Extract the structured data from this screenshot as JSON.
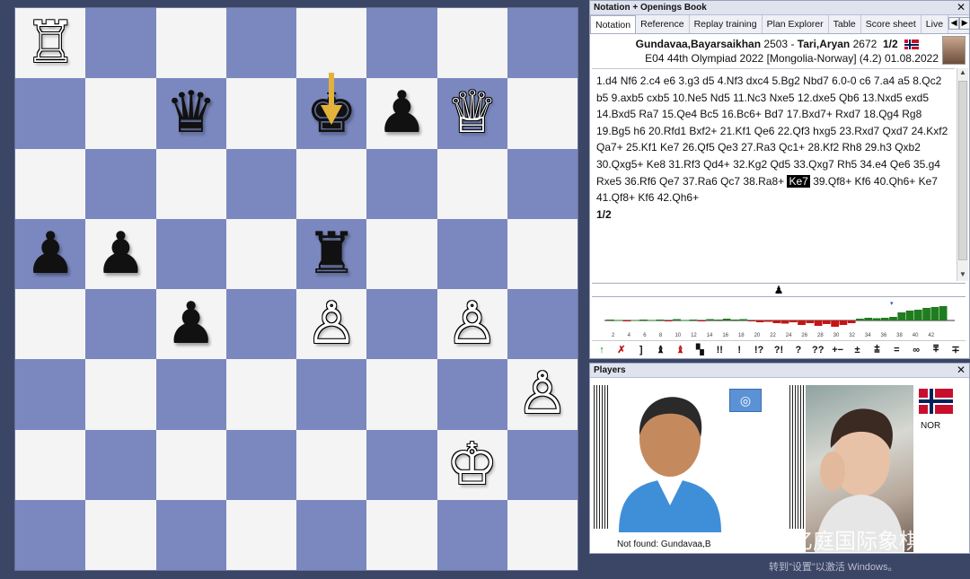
{
  "window": {
    "notation_title": "Notation + Openings Book",
    "players_title": "Players"
  },
  "tabs": [
    {
      "label": "Notation"
    },
    {
      "label": "Reference"
    },
    {
      "label": "Replay training"
    },
    {
      "label": "Plan Explorer"
    },
    {
      "label": "Table"
    },
    {
      "label": "Score sheet"
    },
    {
      "label": "Live"
    }
  ],
  "game": {
    "white": "Gundavaa,Bayarsaikhan",
    "white_elo": "2503",
    "separator": " - ",
    "black": "Tari,Aryan",
    "black_elo": "2672",
    "result": "1/2",
    "line2": "E04 44th Olympiad 2022 [Mongolia-Norway] (4.2) 01.08.2022"
  },
  "moves_before": "1.d4  Nf6  2.c4  e6  3.g3  d5  4.Nf3  dxc4  5.Bg2  Nbd7  6.0-0  c6  7.a4  a5  8.Qc2  b5  9.axb5  cxb5  10.Ne5  Nd5  11.Nc3  Nxe5  12.dxe5  Qb6  13.Nxd5  exd5  14.Bxd5  Ra7  15.Qe4  Bc5  16.Bc6+  Bd7  17.Bxd7+  Rxd7  18.Qg4  Rg8  19.Bg5  h6  20.Rfd1  Bxf2+  21.Kf1  Qe6  22.Qf3  hxg5  23.Rxd7  Qxd7  24.Kxf2  Qa7+  25.Kf1  Ke7  26.Qf5  Qe3  27.Ra3  Qc1+  28.Kf2  Rh8  29.h3  Qxb2  30.Qxg5+  Ke8  31.Rf3  Qd4+  32.Kg2  Qd5  33.Qxg7  Rh5  34.e4  Qe6  35.g4  Rxe5  36.Rf6  Qe7  37.Ra6  Qc7  38.Ra8+",
  "current_move": "Ke7",
  "moves_after": "39.Qf8+  Kf6  40.Qh6+  Ke7  41.Qf8+  Kf6  42.Qh6+",
  "final_result": "1/2",
  "board": {
    "rows": [
      [
        "wR",
        "",
        "",
        "",
        "",
        "",
        "",
        ""
      ],
      [
        "",
        "",
        "bQ",
        "",
        "bK",
        "bP",
        "wQ",
        ""
      ],
      [
        "",
        "",
        "",
        "",
        "",
        "",
        "",
        ""
      ],
      [
        "bP",
        "bP",
        "",
        "",
        "bR",
        "",
        "",
        ""
      ],
      [
        "",
        "",
        "bP",
        "",
        "wP",
        "",
        "wP",
        ""
      ],
      [
        "",
        "",
        "",
        "",
        "",
        "",
        "",
        "wP"
      ],
      [
        "",
        "",
        "",
        "",
        "",
        "",
        "wK",
        ""
      ],
      [
        "",
        "",
        "",
        "",
        "",
        "",
        "",
        ""
      ]
    ],
    "light_color": "#f4f4f4",
    "dark_color": "#7b88bf"
  },
  "eval_chart": {
    "x_ticks": [
      "2",
      "4",
      "6",
      "8",
      "10",
      "12",
      "14",
      "16",
      "18",
      "20",
      "22",
      "24",
      "26",
      "28",
      "30",
      "32",
      "34",
      "36",
      "38",
      "40",
      "42"
    ],
    "values": [
      0.1,
      0.05,
      -0.1,
      0.05,
      0.1,
      0.05,
      0.1,
      -0.1,
      0.15,
      0.05,
      0.1,
      -0.05,
      0.15,
      0.1,
      0.2,
      0.1,
      0.15,
      -0.1,
      -0.2,
      -0.15,
      -0.3,
      -0.35,
      -0.2,
      -0.5,
      -0.3,
      -0.6,
      -0.4,
      -0.7,
      -0.5,
      -0.3,
      0.2,
      0.3,
      0.25,
      0.3,
      0.4,
      0.9,
      1.1,
      1.2,
      1.4,
      1.5,
      1.6
    ],
    "positive_color": "#1f7d1f",
    "negative_color": "#c81414"
  },
  "symbols": [
    {
      "text": "↑",
      "tone": "green"
    },
    {
      "text": "✗",
      "tone": "red"
    },
    {
      "text": "]",
      "tone": ""
    },
    {
      "text": "♝",
      "tone": ""
    },
    {
      "text": "♝",
      "tone": "red"
    },
    {
      "text": "▚",
      "tone": ""
    },
    {
      "text": "!!",
      "tone": ""
    },
    {
      "text": "!",
      "tone": ""
    },
    {
      "text": "!?",
      "tone": ""
    },
    {
      "text": "?!",
      "tone": ""
    },
    {
      "text": "?",
      "tone": ""
    },
    {
      "text": "??",
      "tone": ""
    },
    {
      "text": "+−",
      "tone": ""
    },
    {
      "text": "±",
      "tone": ""
    },
    {
      "text": "⩲",
      "tone": ""
    },
    {
      "text": "=",
      "tone": ""
    },
    {
      "text": "∞",
      "tone": ""
    },
    {
      "text": "⩱",
      "tone": ""
    },
    {
      "text": "∓",
      "tone": ""
    }
  ],
  "players": {
    "left_caption": "Not found: Gundavaa,B",
    "right_country": "NOR"
  },
  "watermark": {
    "text": "亿庭国际象棋",
    "note": "转到\"设置\"以激活 Windows。"
  }
}
